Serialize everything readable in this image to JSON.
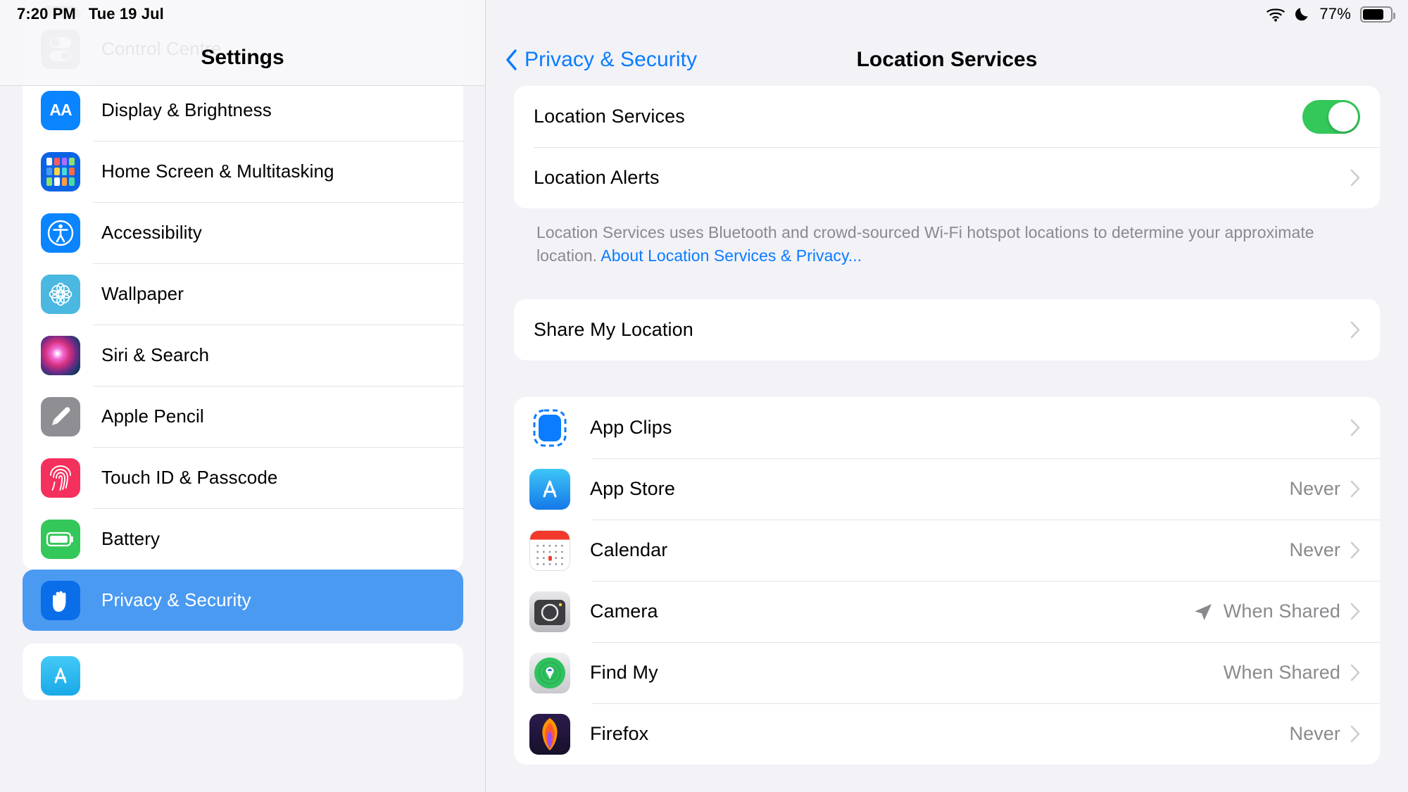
{
  "status_bar": {
    "time": "7:20 PM",
    "date": "Tue 19 Jul",
    "wifi_icon": "wifi-icon",
    "dnd_icon": "moon-icon",
    "battery_percent": "77%",
    "battery_level": 77
  },
  "sidebar": {
    "title": "Settings",
    "items": [
      {
        "label": "Control Centre",
        "icon": "control-centre-icon",
        "selected": false
      },
      {
        "label": "Display & Brightness",
        "icon": "display-brightness-icon",
        "selected": false
      },
      {
        "label": "Home Screen & Multitasking",
        "icon": "home-screen-icon",
        "selected": false
      },
      {
        "label": "Accessibility",
        "icon": "accessibility-icon",
        "selected": false
      },
      {
        "label": "Wallpaper",
        "icon": "wallpaper-icon",
        "selected": false
      },
      {
        "label": "Siri & Search",
        "icon": "siri-icon",
        "selected": false
      },
      {
        "label": "Apple Pencil",
        "icon": "apple-pencil-icon",
        "selected": false
      },
      {
        "label": "Touch ID & Passcode",
        "icon": "touch-id-icon",
        "selected": false
      },
      {
        "label": "Battery",
        "icon": "battery-icon",
        "selected": false
      }
    ],
    "selected_item": {
      "label": "Privacy & Security",
      "icon": "privacy-hand-icon",
      "selected": true
    },
    "selected_color": "#4a9af2"
  },
  "detail": {
    "back_label": "Privacy & Security",
    "title": "Location Services",
    "section_main": [
      {
        "label": "Location Services",
        "control": "toggle",
        "toggle_on": true
      },
      {
        "label": "Location Alerts",
        "control": "chevron"
      }
    ],
    "footnote_text": "Location Services uses Bluetooth and crowd-sourced Wi-Fi hotspot locations to determine your approximate location. ",
    "footnote_link": "About Location Services & Privacy...",
    "section_share": [
      {
        "label": "Share My Location",
        "control": "chevron"
      }
    ],
    "apps": [
      {
        "label": "App Clips",
        "value": "",
        "icon": "app-clips-icon",
        "location_arrow": false
      },
      {
        "label": "App Store",
        "value": "Never",
        "icon": "app-store-icon",
        "location_arrow": false
      },
      {
        "label": "Calendar",
        "value": "Never",
        "icon": "calendar-icon",
        "location_arrow": false
      },
      {
        "label": "Camera",
        "value": "When Shared",
        "icon": "camera-icon",
        "location_arrow": true
      },
      {
        "label": "Find My",
        "value": "When Shared",
        "icon": "find-my-icon",
        "location_arrow": false
      },
      {
        "label": "Firefox",
        "value": "Never",
        "icon": "firefox-icon",
        "location_arrow": false
      }
    ]
  },
  "colors": {
    "accent_blue": "#0a7cff",
    "toggle_green": "#34c759",
    "background": "#f2f2f7",
    "secondary_text": "#8a8a8e"
  }
}
